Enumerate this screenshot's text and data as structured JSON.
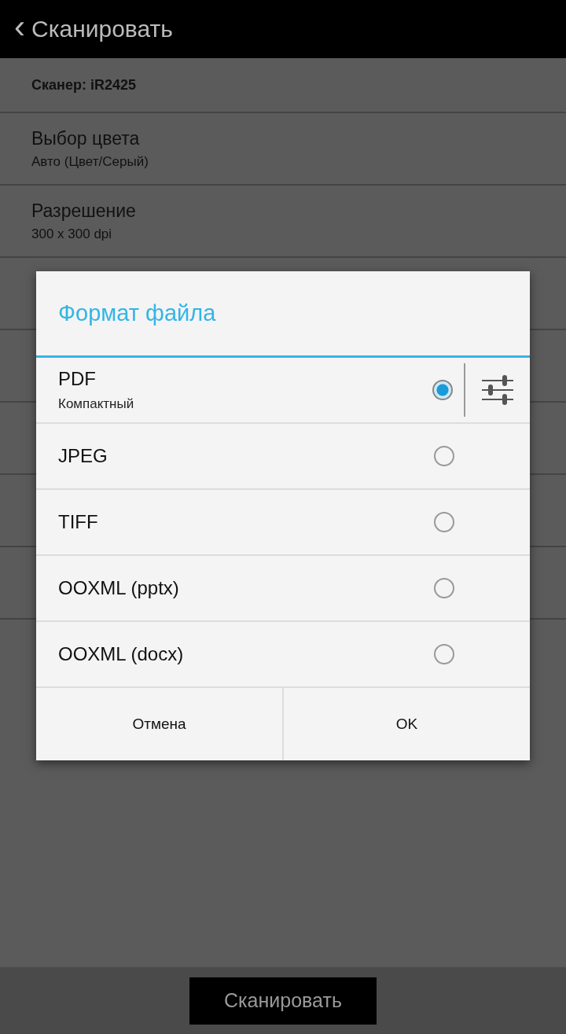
{
  "header": {
    "back": "‹",
    "title": "Сканировать"
  },
  "scanner": "Сканер: iR2425",
  "settings": [
    {
      "title": "Выбор цвета",
      "value": "Авто (Цвет/Серый)"
    },
    {
      "title": "Разрешение",
      "value": "300 x 300 dpi"
    }
  ],
  "dialog": {
    "title": "Формат файла",
    "options": [
      {
        "label": "PDF",
        "sublabel": "Компактный",
        "selected": true,
        "has_settings": true
      },
      {
        "label": "JPEG",
        "selected": false,
        "has_settings": false
      },
      {
        "label": "TIFF",
        "selected": false,
        "has_settings": false
      },
      {
        "label": "OOXML (pptx)",
        "selected": false,
        "has_settings": false
      },
      {
        "label": "OOXML (docx)",
        "selected": false,
        "has_settings": false
      }
    ],
    "buttons": [
      "Отмена",
      "OK"
    ]
  },
  "scan_button": "Сканировать"
}
